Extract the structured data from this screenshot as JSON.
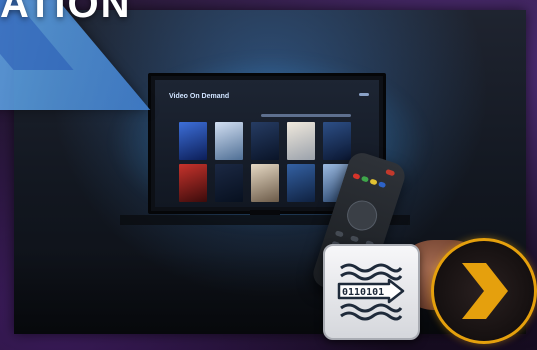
{
  "banner": {
    "headline": "ATION"
  },
  "tv_screen": {
    "title": "Video On Demand"
  },
  "icons": {
    "converter": "binary-conversion-icon",
    "converter_binary": "0110101",
    "plex": "plex-chevron-icon",
    "plex_color": "#e5a00d",
    "remote": "tv-remote-icon"
  }
}
